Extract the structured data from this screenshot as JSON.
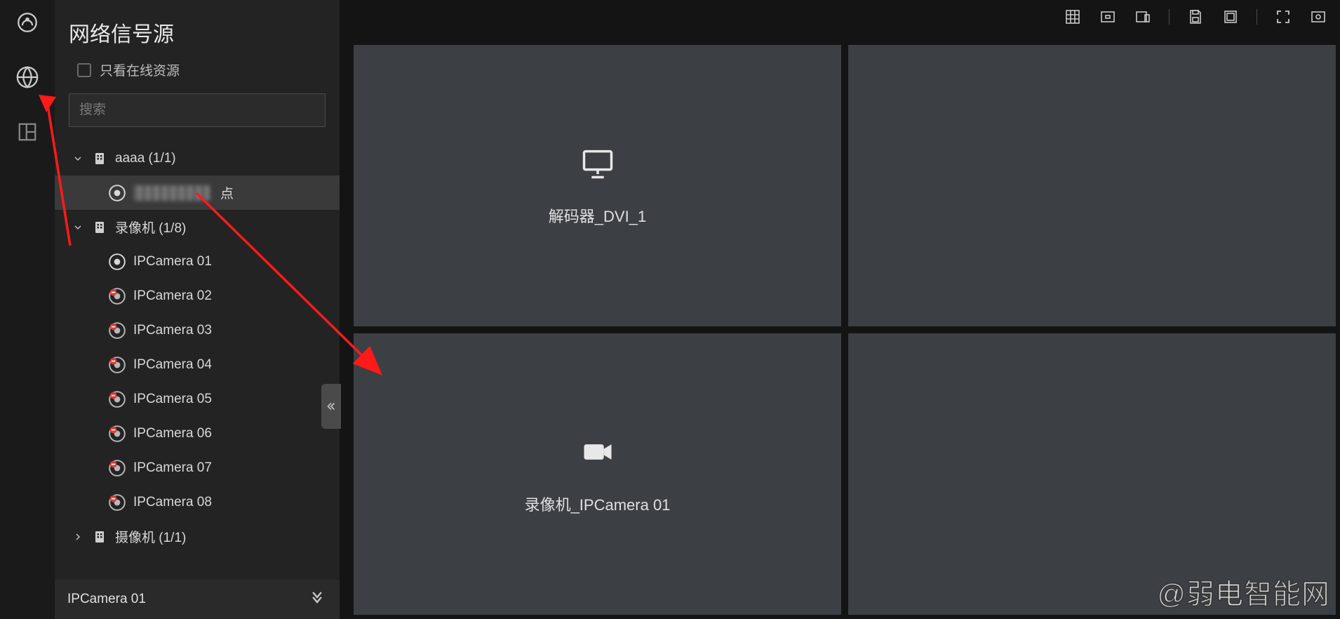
{
  "rail": {
    "icons": [
      "dashboard-icon",
      "globe-icon",
      "layout-icon"
    ]
  },
  "sidebar": {
    "title": "网络信号源",
    "filter_label": "只看在线资源",
    "search_placeholder": "搜索",
    "groups": [
      {
        "label": "aaaa (1/1)",
        "expanded": true,
        "children": [
          {
            "label_suffix": "点",
            "status": "online",
            "selected": true,
            "masked": true
          }
        ]
      },
      {
        "label": "录像机 (1/8)",
        "expanded": true,
        "children": [
          {
            "label": "IPCamera 01",
            "status": "online"
          },
          {
            "label": "IPCamera 02",
            "status": "offline"
          },
          {
            "label": "IPCamera 03",
            "status": "offline"
          },
          {
            "label": "IPCamera 04",
            "status": "offline"
          },
          {
            "label": "IPCamera 05",
            "status": "offline"
          },
          {
            "label": "IPCamera 06",
            "status": "offline"
          },
          {
            "label": "IPCamera 07",
            "status": "offline"
          },
          {
            "label": "IPCamera 08",
            "status": "offline"
          }
        ]
      },
      {
        "label": "摄像机 (1/1)",
        "expanded": false
      }
    ],
    "footer_label": "IPCamera 01"
  },
  "toolbar": {
    "buttons": [
      "grid-icon",
      "single-view-icon",
      "device-icon",
      "save-icon",
      "window-icon",
      "fullscreen-icon",
      "settings-icon"
    ]
  },
  "cells": [
    {
      "icon": "monitor-icon",
      "label": "解码器_DVI_1"
    },
    {
      "icon": null,
      "label": null
    },
    {
      "icon": "camera-icon",
      "label": "录像机_IPCamera 01"
    },
    {
      "icon": null,
      "label": null
    }
  ],
  "watermark": "@弱电智能网"
}
